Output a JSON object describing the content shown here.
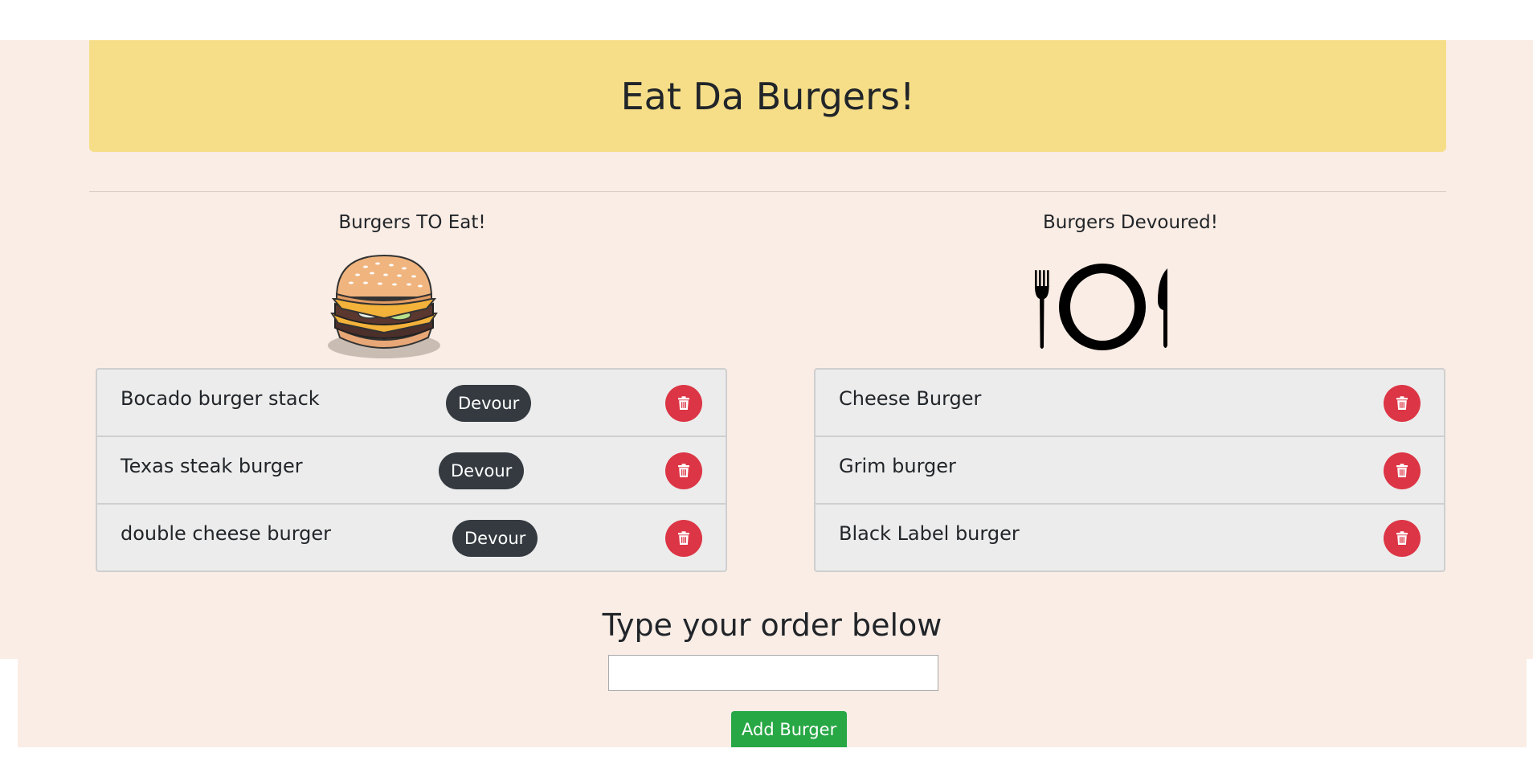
{
  "header": {
    "title": "Eat Da Burgers!"
  },
  "to_eat": {
    "title": "Burgers TO Eat!",
    "illustration": "burger-illustration",
    "devour_label": "Devour",
    "items": [
      {
        "name": "Bocado burger stack"
      },
      {
        "name": "Texas steak burger"
      },
      {
        "name": "double cheese burger"
      }
    ]
  },
  "devoured": {
    "title": "Burgers Devoured!",
    "illustration": "plate-fork-knife-icon",
    "items": [
      {
        "name": "Cheese Burger"
      },
      {
        "name": "Grim burger"
      },
      {
        "name": "Black Label burger"
      }
    ]
  },
  "order_form": {
    "title": "Type your order below",
    "input_value": "",
    "submit_label": "Add Burger"
  },
  "icons": {
    "delete": "trash-icon"
  },
  "colors": {
    "page_bg": "#faede5",
    "header_bg": "#f6de88",
    "devour_button": "#343a40",
    "delete_button": "#dc3545",
    "add_button": "#28a745"
  }
}
